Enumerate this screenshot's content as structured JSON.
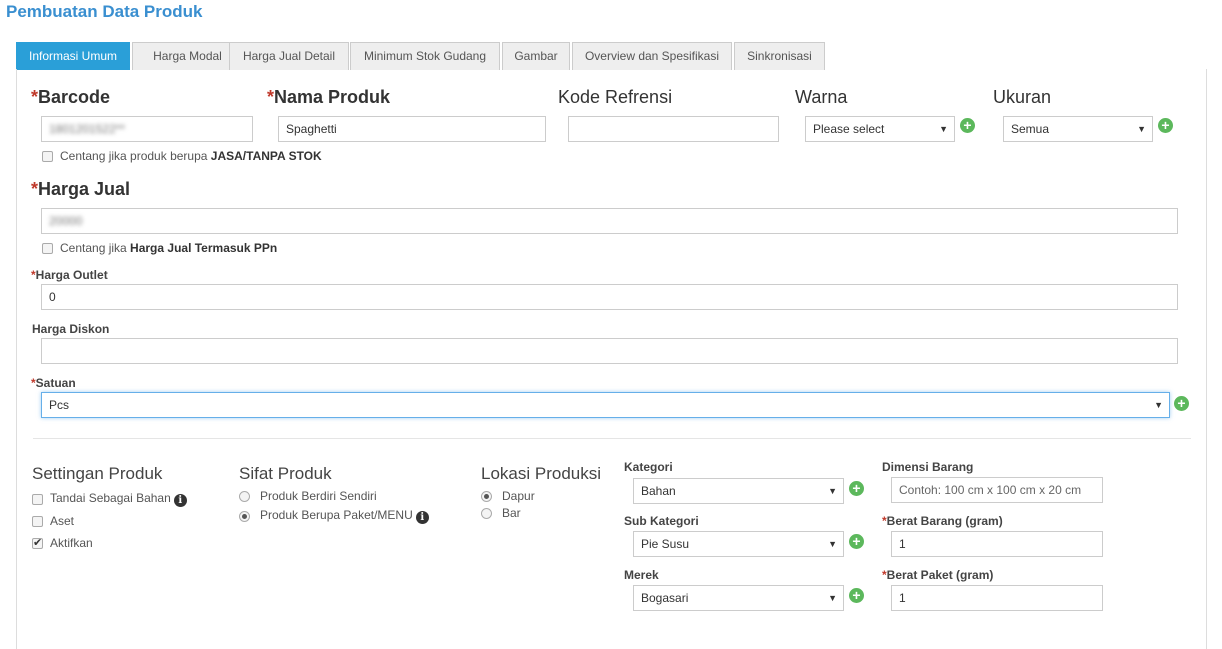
{
  "page_title": "Pembuatan Data Produk",
  "tabs": [
    {
      "label": "Informasi Umum",
      "active": true
    },
    {
      "label": "Harga Modal"
    },
    {
      "label": "Harga Jual Detail"
    },
    {
      "label": "Minimum Stok Gudang"
    },
    {
      "label": "Gambar"
    },
    {
      "label": "Overview dan Spesifikasi"
    },
    {
      "label": "Sinkronisasi"
    }
  ],
  "required_mark": "*",
  "barcode": {
    "label": "Barcode",
    "value": "1801201522**"
  },
  "nama_produk": {
    "label": "Nama Produk",
    "value": "Spaghetti"
  },
  "kode_refrensi": {
    "label": "Kode Refrensi",
    "value": ""
  },
  "warna": {
    "label": "Warna",
    "selected": "Please select"
  },
  "ukuran": {
    "label": "Ukuran",
    "selected": "Semua"
  },
  "jasa_checkbox": {
    "label_prefix": "Centang jika produk berupa ",
    "label_bold": "JASA/TANPA STOK",
    "checked": false
  },
  "harga_jual": {
    "label": "Harga Jual",
    "value": "20000"
  },
  "ppn_checkbox": {
    "label_prefix": "Centang jika ",
    "label_bold": "Harga Jual Termasuk PPn",
    "checked": false
  },
  "harga_outlet": {
    "label": "Harga Outlet",
    "value": "0"
  },
  "harga_diskon": {
    "label": "Harga Diskon",
    "value": ""
  },
  "satuan": {
    "label": "Satuan",
    "selected": "Pcs"
  },
  "settingan_produk": {
    "title": "Settingan Produk",
    "items": [
      {
        "label": "Tandai Sebagai Bahan",
        "checked": false
      },
      {
        "label": "Aset",
        "checked": false
      },
      {
        "label": "Aktifkan",
        "checked": true
      }
    ]
  },
  "sifat_produk": {
    "title": "Sifat Produk",
    "options": [
      {
        "label": "Produk Berdiri Sendiri",
        "selected": false
      },
      {
        "label": "Produk Berupa Paket/MENU",
        "selected": true
      }
    ]
  },
  "lokasi_produksi": {
    "title": "Lokasi Produksi",
    "options": [
      {
        "label": "Dapur",
        "selected": true
      },
      {
        "label": "Bar",
        "selected": false
      }
    ]
  },
  "kategori": {
    "label": "Kategori",
    "selected": "Bahan"
  },
  "sub_kategori": {
    "label": "Sub Kategori",
    "selected": "Pie Susu"
  },
  "merek": {
    "label": "Merek",
    "selected": "Bogasari"
  },
  "dimensi_barang": {
    "label": "Dimensi Barang",
    "placeholder": "Contoh: 100 cm x 100 cm x 20 cm"
  },
  "berat_barang": {
    "label": "Berat Barang (gram)",
    "value": "1"
  },
  "berat_paket": {
    "label": "Berat Paket (gram)",
    "value": "1"
  },
  "icons": {
    "add": "plus-circle-icon",
    "info": "info-circle-icon",
    "dropdown": "caret-down-icon"
  },
  "colors": {
    "accent": "#2a9fd8",
    "title": "#3a8fd0",
    "add_button": "#5cb85c",
    "required": "#c0392b"
  }
}
